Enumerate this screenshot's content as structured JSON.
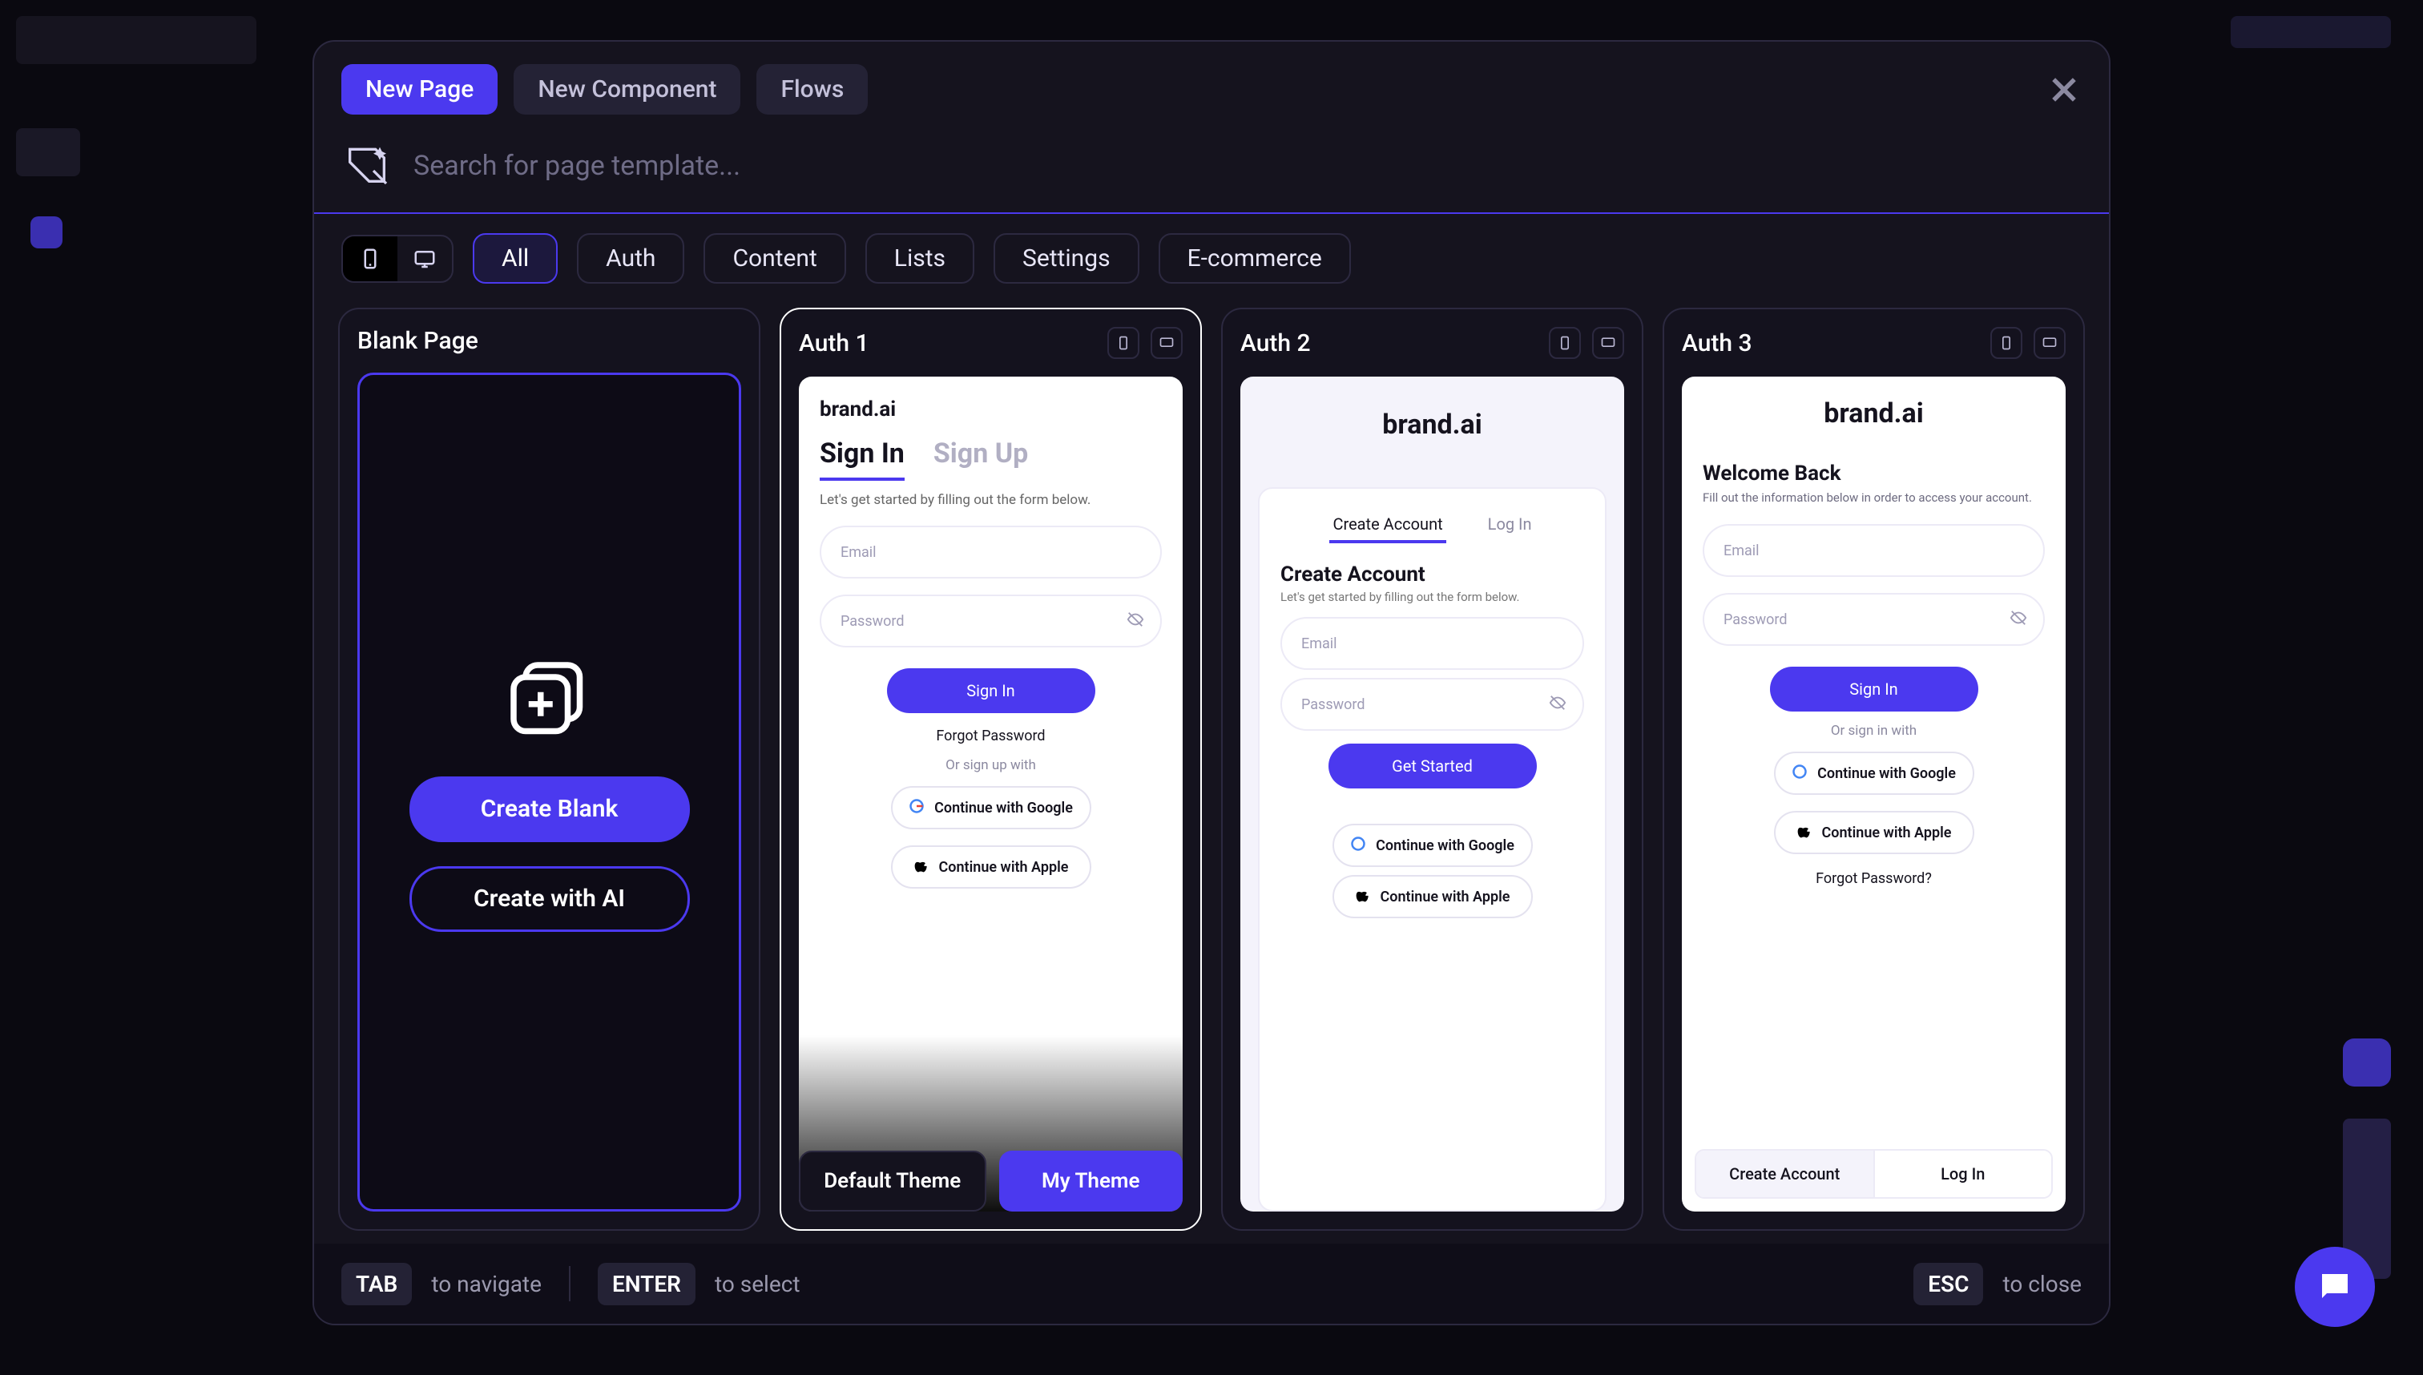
{
  "tabs": {
    "new_page": "New Page",
    "new_component": "New Component",
    "flows": "Flows"
  },
  "search": {
    "placeholder": "Search for page template..."
  },
  "filters": {
    "all": "All",
    "auth": "Auth",
    "content": "Content",
    "lists": "Lists",
    "settings": "Settings",
    "ecommerce": "E-commerce"
  },
  "cards": {
    "blank": {
      "title": "Blank Page",
      "create_blank": "Create Blank",
      "create_ai": "Create with AI"
    },
    "auth1": {
      "title": "Auth 1",
      "brand": "brand.ai",
      "tab_signin": "Sign In",
      "tab_signup": "Sign Up",
      "hint": "Let's get started by filling out the form below.",
      "email": "Email",
      "password": "Password",
      "cta": "Sign In",
      "forgot": "Forgot Password",
      "or": "Or sign up with",
      "google": "Continue with Google",
      "apple": "Continue with Apple",
      "theme_default": "Default Theme",
      "theme_my": "My Theme"
    },
    "auth2": {
      "title": "Auth 2",
      "brand": "brand.ai",
      "tab_create": "Create Account",
      "tab_login": "Log In",
      "h": "Create Account",
      "sub": "Let's get started by filling out the form below.",
      "email": "Email",
      "password": "Password",
      "cta": "Get Started",
      "google": "Continue with Google",
      "apple": "Continue with Apple"
    },
    "auth3": {
      "title": "Auth 3",
      "brand": "brand.ai",
      "wb": "Welcome Back",
      "wb_sub": "Fill out the information below in order to access your account.",
      "email": "Email",
      "password": "Password",
      "cta": "Sign In",
      "or": "Or sign in with",
      "google": "Continue with Google",
      "apple": "Continue with Apple",
      "forgot": "Forgot Password?",
      "create": "Create Account",
      "login": "Log In"
    }
  },
  "footer": {
    "tab": "TAB",
    "tab_hint": "to navigate",
    "enter": "ENTER",
    "enter_hint": "to select",
    "esc": "ESC",
    "esc_hint": "to close"
  }
}
